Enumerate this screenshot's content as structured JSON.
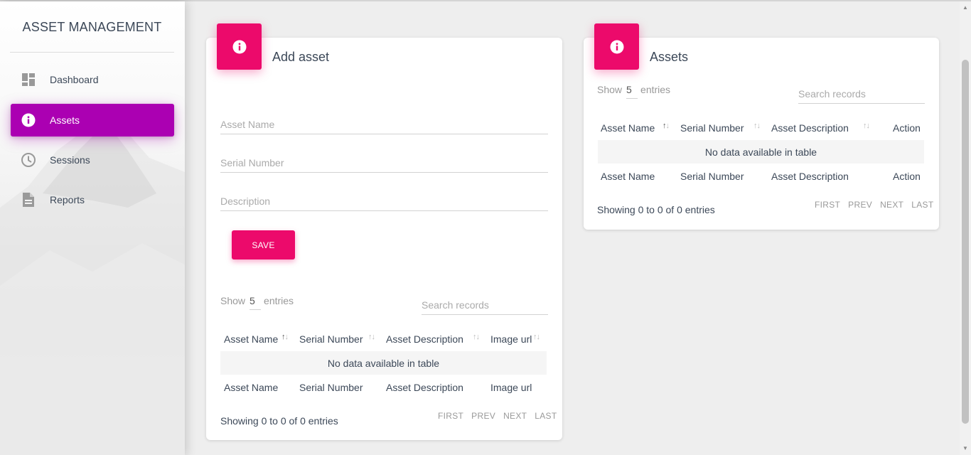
{
  "app": {
    "title": "ASSET MANAGEMENT"
  },
  "sidebar": {
    "items": [
      {
        "label": "Dashboard",
        "icon": "dashboard-icon"
      },
      {
        "label": "Assets",
        "icon": "info-icon",
        "active": true
      },
      {
        "label": "Sessions",
        "icon": "clock-icon"
      },
      {
        "label": "Reports",
        "icon": "document-icon"
      }
    ],
    "active_color": "#ab00b2"
  },
  "add_asset": {
    "title": "Add asset",
    "icon": "info-icon",
    "fields": {
      "asset_name_placeholder": "Asset Name",
      "serial_number_placeholder": "Serial Number",
      "description_placeholder": "Description"
    },
    "save_label": "SAVE",
    "table": {
      "show_label": "Show",
      "page_size": "5",
      "entries_label": "entries",
      "search_placeholder": "Search records",
      "columns": [
        "Asset Name",
        "Serial Number",
        "Asset Description",
        "Image url"
      ],
      "empty_message": "No data available in table",
      "info": "Showing 0 to 0 of 0 entries",
      "pager": [
        "FIRST",
        "PREV",
        "NEXT",
        "LAST"
      ]
    }
  },
  "assets": {
    "title": "Assets",
    "icon": "info-icon",
    "table": {
      "show_label": "Show",
      "page_size": "5",
      "entries_label": "entries",
      "search_placeholder": "Search records",
      "columns": [
        "Asset Name",
        "Serial Number",
        "Asset Description",
        "Action"
      ],
      "empty_message": "No data available in table",
      "info": "Showing 0 to 0 of 0 entries",
      "pager": [
        "FIRST",
        "PREV",
        "NEXT",
        "LAST"
      ]
    }
  },
  "colors": {
    "accent": "#ec0a6b",
    "sidebar_active": "#ab00b2"
  }
}
